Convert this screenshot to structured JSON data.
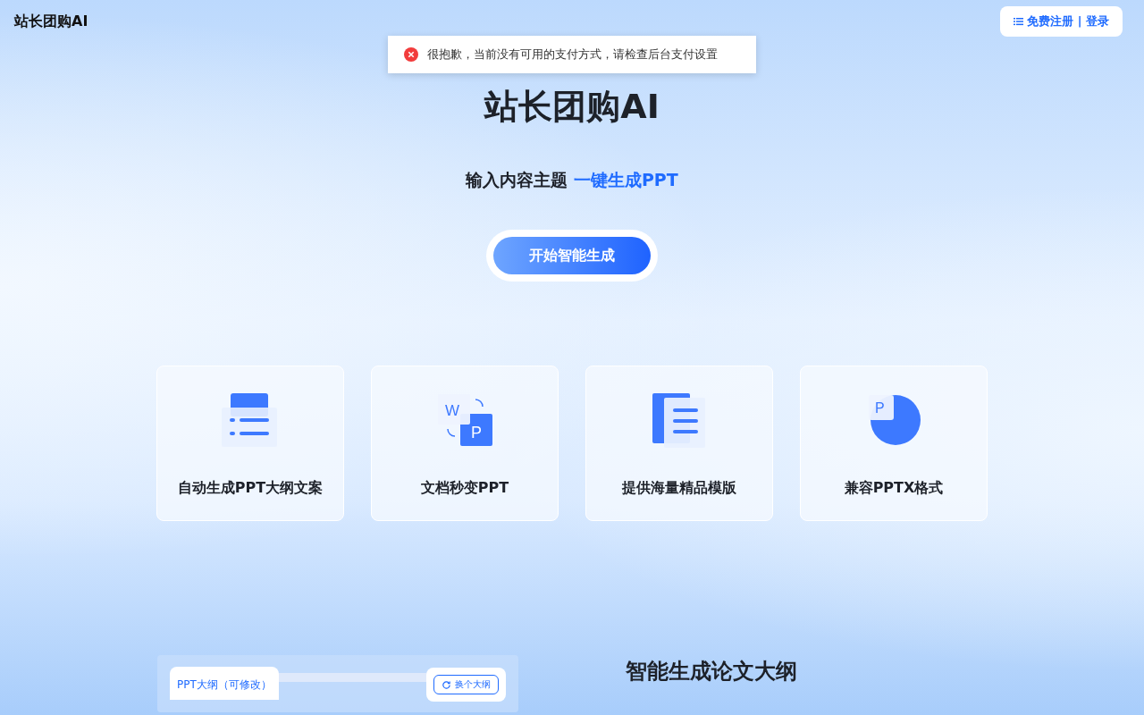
{
  "brand": "站长团购AI",
  "auth_button": {
    "label": "免费注册 | 登录"
  },
  "toast": {
    "kind": "error",
    "message": "很抱歉，当前没有可用的支付方式，请检查后台支付设置"
  },
  "hero": {
    "title": "站长团购AI",
    "subtitle": "输入内容主题 **一键生成PPT**",
    "cta": "开始智能生成"
  },
  "features": [
    {
      "kind": "outline",
      "label": "自动生成PPT大纲文案"
    },
    {
      "kind": "convert",
      "label": "文档秒变PPT",
      "icon_letters": [
        "W",
        "P"
      ]
    },
    {
      "kind": "templates",
      "label": "提供海量精品模版"
    },
    {
      "kind": "pptx",
      "label": "兼容PPTX格式",
      "icon_letters": [
        "P"
      ]
    }
  ],
  "preview": {
    "tab": "PPT大纲（可修改）",
    "button": "换个大纲"
  },
  "section_title": "智能生成论文大纲"
}
